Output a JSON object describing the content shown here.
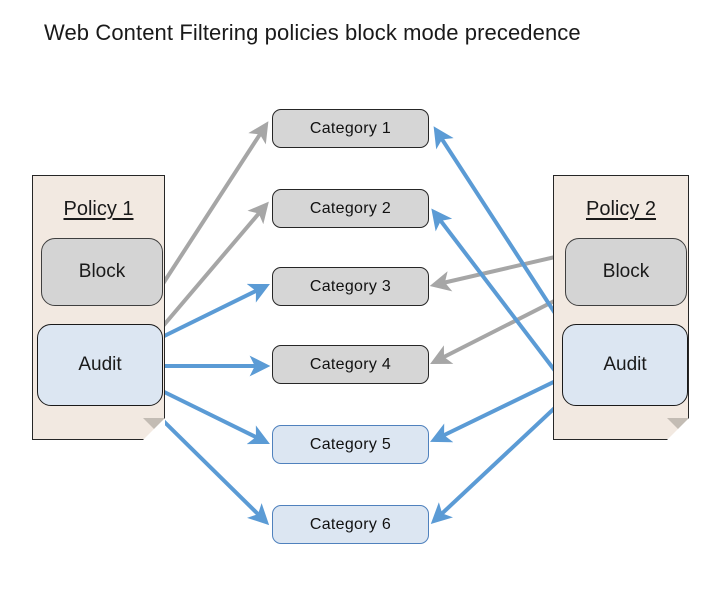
{
  "title": "Web Content Filtering policies block mode precedence",
  "colors": {
    "policy_fill": "#f2e9e1",
    "policy_border": "#262626",
    "block_fill": "#d4d4d4",
    "block_border": "#3f3f3f",
    "audit_fill": "#dce6f2",
    "audit_border": "#1a1a1a",
    "category_gray_fill": "#d6d6d6",
    "category_gray_border": "#262626",
    "category_blue_fill": "#dce6f2",
    "category_blue_border": "#4f81bd",
    "arrow_gray": "#a6a6a6",
    "arrow_blue": "#5b9bd5",
    "background": "#ffffff"
  },
  "policies": [
    {
      "id": "policy-1",
      "title": "Policy 1",
      "side": "left",
      "modes": [
        {
          "id": "policy-1-block",
          "label": "Block",
          "style": "block"
        },
        {
          "id": "policy-1-audit",
          "label": "Audit",
          "style": "audit"
        }
      ]
    },
    {
      "id": "policy-2",
      "title": "Policy 2",
      "side": "right",
      "modes": [
        {
          "id": "policy-2-block",
          "label": "Block",
          "style": "block"
        },
        {
          "id": "policy-2-audit",
          "label": "Audit",
          "style": "audit"
        }
      ]
    }
  ],
  "categories": [
    {
      "id": "category-1",
      "label": "Category  1",
      "effective_mode": "block",
      "style": "gray"
    },
    {
      "id": "category-2",
      "label": "Category  2",
      "effective_mode": "block",
      "style": "gray"
    },
    {
      "id": "category-3",
      "label": "Category  3",
      "effective_mode": "block",
      "style": "gray"
    },
    {
      "id": "category-4",
      "label": "Category  4",
      "effective_mode": "block",
      "style": "gray"
    },
    {
      "id": "category-5",
      "label": "Category  5",
      "effective_mode": "audit",
      "style": "blue"
    },
    {
      "id": "category-6",
      "label": "Category  6",
      "effective_mode": "audit",
      "style": "blue"
    }
  ],
  "connections": [
    {
      "from": "policy-1-block",
      "to": "category-1",
      "color": "gray"
    },
    {
      "from": "policy-1-block",
      "to": "category-2",
      "color": "gray"
    },
    {
      "from": "policy-1-audit",
      "to": "category-3",
      "color": "blue"
    },
    {
      "from": "policy-1-audit",
      "to": "category-4",
      "color": "blue"
    },
    {
      "from": "policy-1-audit",
      "to": "category-5",
      "color": "blue"
    },
    {
      "from": "policy-1-audit",
      "to": "category-6",
      "color": "blue"
    },
    {
      "from": "policy-2-block",
      "to": "category-3",
      "color": "gray"
    },
    {
      "from": "policy-2-block",
      "to": "category-4",
      "color": "gray"
    },
    {
      "from": "policy-2-audit",
      "to": "category-1",
      "color": "blue"
    },
    {
      "from": "policy-2-audit",
      "to": "category-2",
      "color": "blue"
    },
    {
      "from": "policy-2-audit",
      "to": "category-5",
      "color": "blue"
    },
    {
      "from": "policy-2-audit",
      "to": "category-6",
      "color": "blue"
    }
  ]
}
